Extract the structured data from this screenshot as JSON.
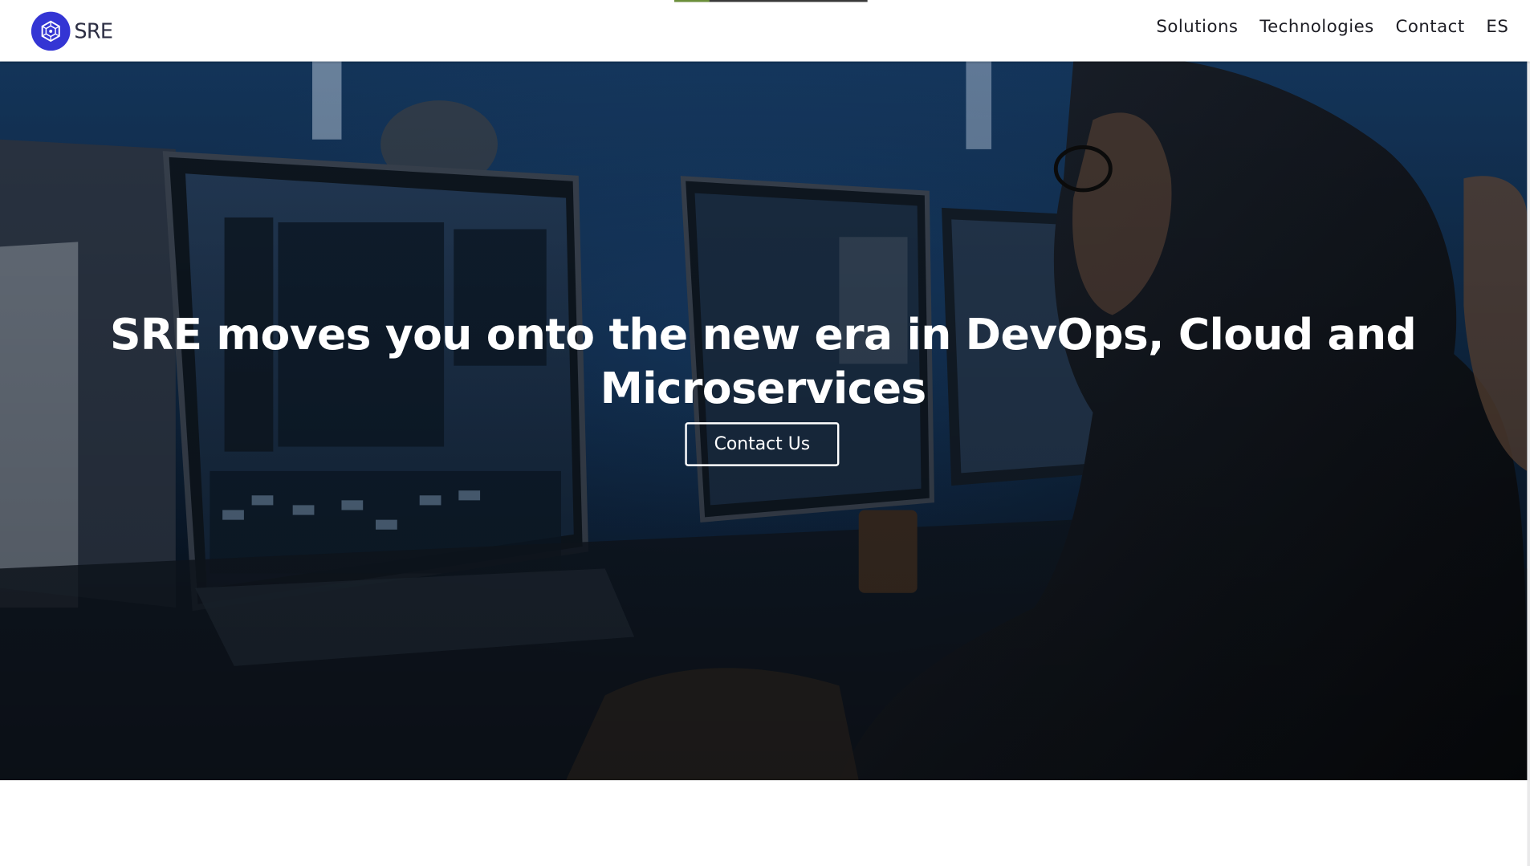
{
  "header": {
    "brand_name": "SRE",
    "logo_icon": "hexagon-network-logo-icon",
    "accent_color": "#3435d4",
    "nav_items": [
      {
        "label": "Solutions"
      },
      {
        "label": "Technologies"
      },
      {
        "label": "Contact"
      },
      {
        "label": "ES"
      }
    ]
  },
  "hero": {
    "heading": "SRE moves you onto the new era in DevOps, Cloud and Microservices",
    "cta_label": "Contact Us",
    "background_image": "developer-workstations-photo"
  }
}
